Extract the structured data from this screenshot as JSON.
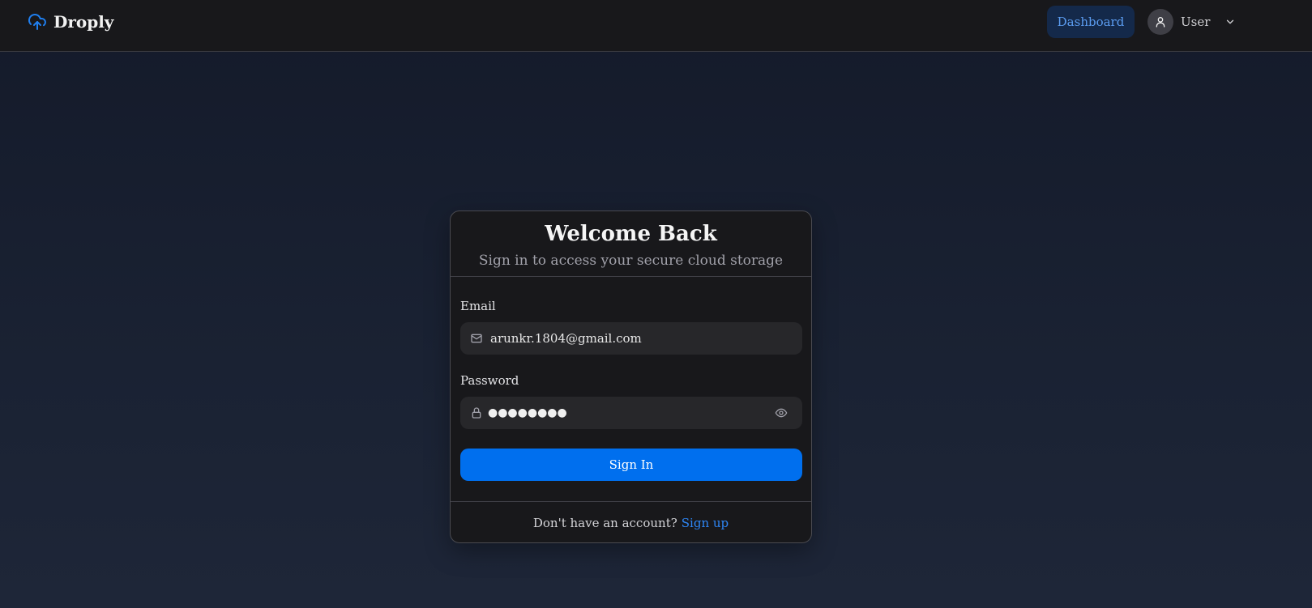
{
  "header": {
    "brand": "Droply",
    "dashboard_label": "Dashboard",
    "user_label": "User"
  },
  "login": {
    "title": "Welcome Back",
    "subtitle": "Sign in to access your secure cloud storage",
    "email_label": "Email",
    "email_value": "arunkr.1804@gmail.com",
    "password_label": "Password",
    "password_value": "●●●●●●●●",
    "submit_label": "Sign In",
    "footer_prompt": "Don't have an account?",
    "footer_link": "Sign up"
  },
  "icons": {
    "brand": "cloud-upload-icon",
    "avatar": "user-icon",
    "menu": "chevron-down-icon",
    "email": "mail-icon",
    "password": "lock-icon",
    "toggle": "eye-icon"
  },
  "colors": {
    "accent": "#006fee",
    "link": "#2e86f5",
    "dashboard_bg": "#14294a",
    "dashboard_text": "#5b9cf0"
  }
}
